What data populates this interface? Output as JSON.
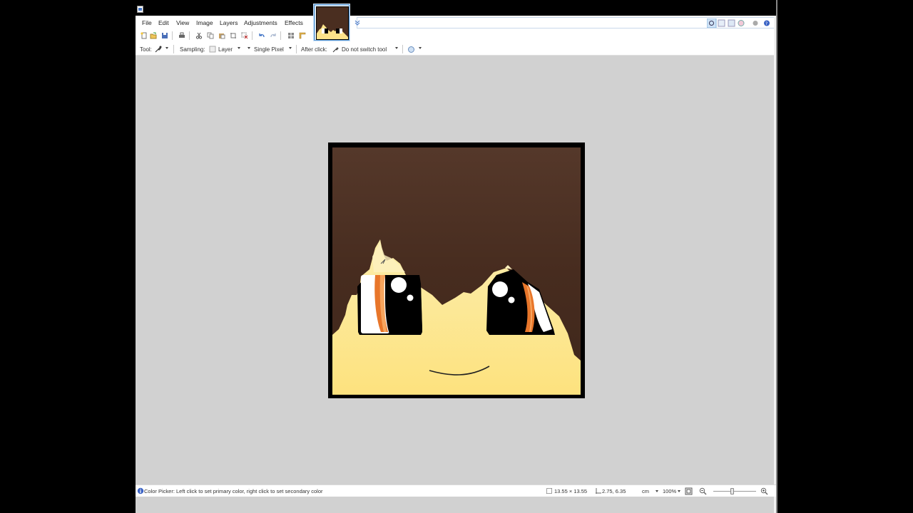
{
  "menu": {
    "items": [
      "File",
      "Edit",
      "View",
      "Image",
      "Layers",
      "Adjustments",
      "Effects"
    ]
  },
  "options": {
    "tool_label": "Tool:",
    "sampling_label": "Sampling:",
    "sampling_layer": "Layer",
    "sampling_mode": "Single Pixel",
    "after_click_label": "After click:",
    "after_click_value": "Do not switch tool"
  },
  "status": {
    "hint": "Color Picker: Left click to set primary color, right click to set secondary color",
    "image_size": "13.55 × 13.55",
    "cursor_pos": "2.75, 6.35",
    "units": "cm",
    "zoom": "100%"
  },
  "image": {
    "hair_color": "#472c1f",
    "skin_color": "#fde38a",
    "iris_color": "#e8762a",
    "frame_color": "#000000"
  },
  "colors": {
    "accent": "#5a9ad6",
    "canvas_bg": "#d1d1d1"
  }
}
